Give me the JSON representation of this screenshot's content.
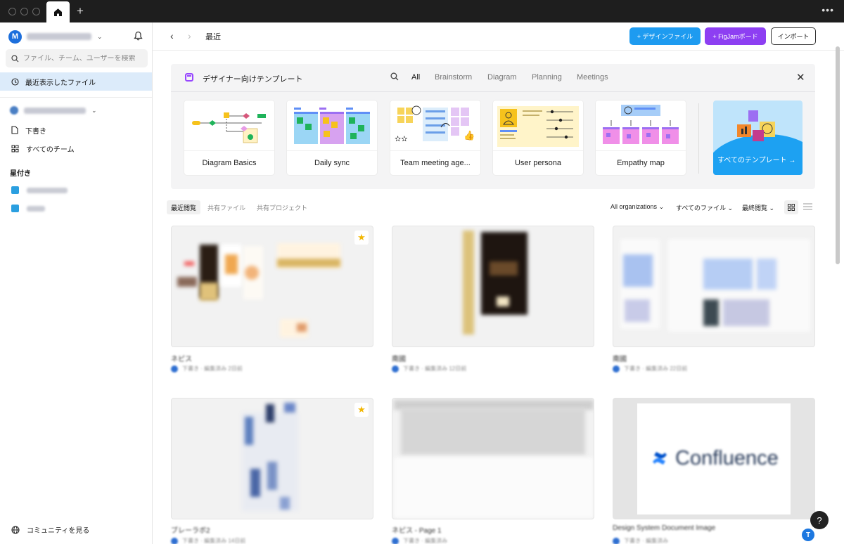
{
  "app": {
    "account_initial": "M",
    "colors": {
      "accent_blue": "#1e9bf0",
      "accent_purple": "#8d3ff2",
      "selected_bg": "#dcebfa"
    }
  },
  "sidebar": {
    "search_placeholder": "ファイル、チーム、ユーザーを検索",
    "recent_label": "最近表示したファイル",
    "drafts_label": "下書き",
    "all_teams_label": "すべてのチーム",
    "starred_header": "星付き",
    "community_label": "コミュニティを見る"
  },
  "topbar": {
    "title": "最近",
    "design_file_button": "+ デザインファイル",
    "figjam_button": "+ FigJamボード",
    "import_button": "インポート"
  },
  "templates": {
    "title": "デザイナー向けテンプレート",
    "filters": [
      "All",
      "Brainstorm",
      "Diagram",
      "Planning",
      "Meetings"
    ],
    "cards": [
      "Diagram Basics",
      "Daily sync",
      "Team meeting age...",
      "User persona",
      "Empathy map"
    ],
    "all_templates_label": "すべてのテンプレート →"
  },
  "files": {
    "tabs": [
      "最近閲覧",
      "共有ファイル",
      "共有プロジェクト"
    ],
    "org_filter": "All organizations",
    "type_filter": "すべてのファイル",
    "sort_filter": "最終閲覧",
    "confluence_text": "Confluence"
  },
  "help_label": "?",
  "user_initial": "T"
}
